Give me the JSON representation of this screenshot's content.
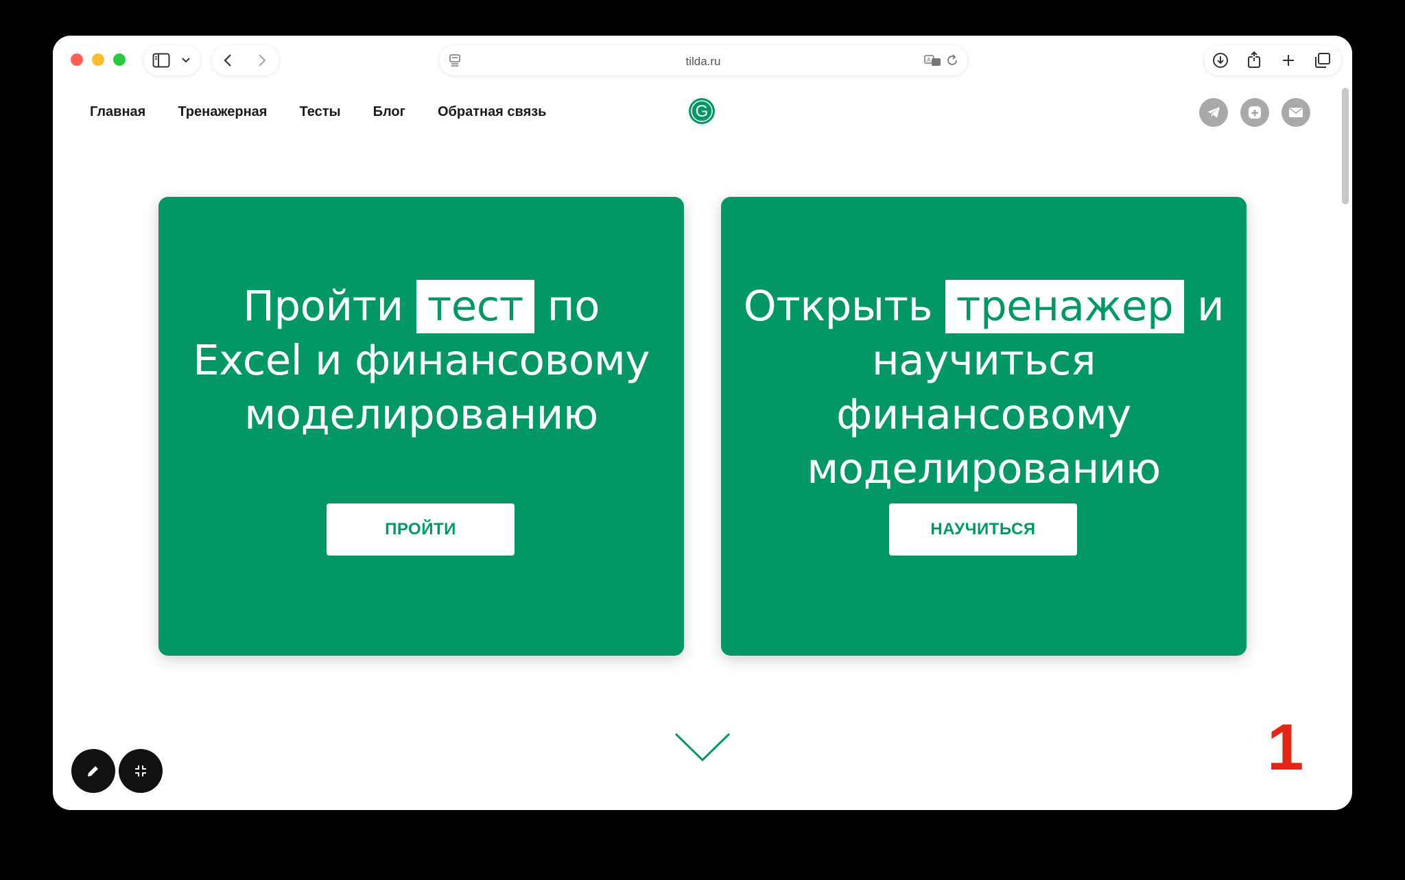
{
  "browser": {
    "url": "tilda.ru",
    "icons": [
      "sidebar-icon",
      "chevron-down-icon",
      "back-icon",
      "forward-icon",
      "reader-icon",
      "translate-icon",
      "reload-icon",
      "download-icon",
      "share-icon",
      "new-tab-icon",
      "tabs-overview-icon"
    ]
  },
  "site": {
    "nav": [
      "Главная",
      "Тренажерная",
      "Тесты",
      "Блог",
      "Обратная связь"
    ],
    "logo_letter": "G",
    "social_icons": [
      "telegram-icon",
      "vk-icon",
      "mail-icon"
    ]
  },
  "cards": [
    {
      "pre": "Пройти ",
      "highlight": "тест",
      "post": " по",
      "line2": "Excel и финансовому",
      "line3": "моделированию",
      "button": "ПРОЙТИ"
    },
    {
      "pre": "Открыть ",
      "highlight": "тренажер",
      "post": " и",
      "line2": "научиться финансовому",
      "line3": "моделированию",
      "button": "НАУЧИТЬСЯ"
    }
  ],
  "page_number": "1",
  "colors": {
    "brand_green": "#039768",
    "page_number_red": "#e02718",
    "social_grey": "#a9a9a9"
  }
}
